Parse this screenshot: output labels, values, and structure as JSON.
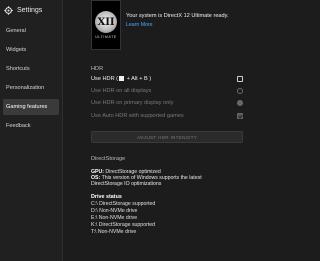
{
  "window": {
    "title": "Settings"
  },
  "sidebar": {
    "items": [
      {
        "label": "General"
      },
      {
        "label": "Widgets"
      },
      {
        "label": "Shortcuts"
      },
      {
        "label": "Personalization"
      },
      {
        "label": "Gaming features"
      },
      {
        "label": "Feedback"
      }
    ],
    "active": "Gaming features"
  },
  "banner": {
    "logo_text": "XII",
    "logo_sub": "ULTIMATE",
    "ready_text": "Your system is DirectX 12 Ultimate ready.",
    "learn_more": "Learn More"
  },
  "hdr": {
    "section_title": "HDR",
    "use_hdr_prefix": "Use HDR (",
    "use_hdr_suffix": " + Alt + B )",
    "all_displays": "Use HDR on all displays",
    "primary_only": "Use HDR on primary display only",
    "auto_hdr": "Use Auto HDR with supported games",
    "adjust_button": "ADJUST HDR INTENSITY",
    "icons": {
      "windows_key": "windows-key-icon"
    }
  },
  "directstorage": {
    "section_title": "DirectStorage",
    "gpu_label": "GPU:",
    "gpu_value": "DirectStorage optimized",
    "os_label": "OS:",
    "os_value_line1": "This version of Windows supports the latest",
    "os_value_line2": "DirectStorage IO optimizations",
    "drive_status_title": "Drive status",
    "drives": [
      "C:\\ DirectStorage supported",
      "D:\\ Non-NVMe drive",
      "E:\\ Non-NVMe drive",
      "K:\\ DirectStorage supported",
      "T:\\ Non-NVMe drive"
    ]
  },
  "colors": {
    "background": "#1c1c1c",
    "sidebar": "#202020",
    "active_item": "#3a3a3a",
    "link": "#4aa8ff",
    "radio_selected": "#2d6cb3"
  }
}
